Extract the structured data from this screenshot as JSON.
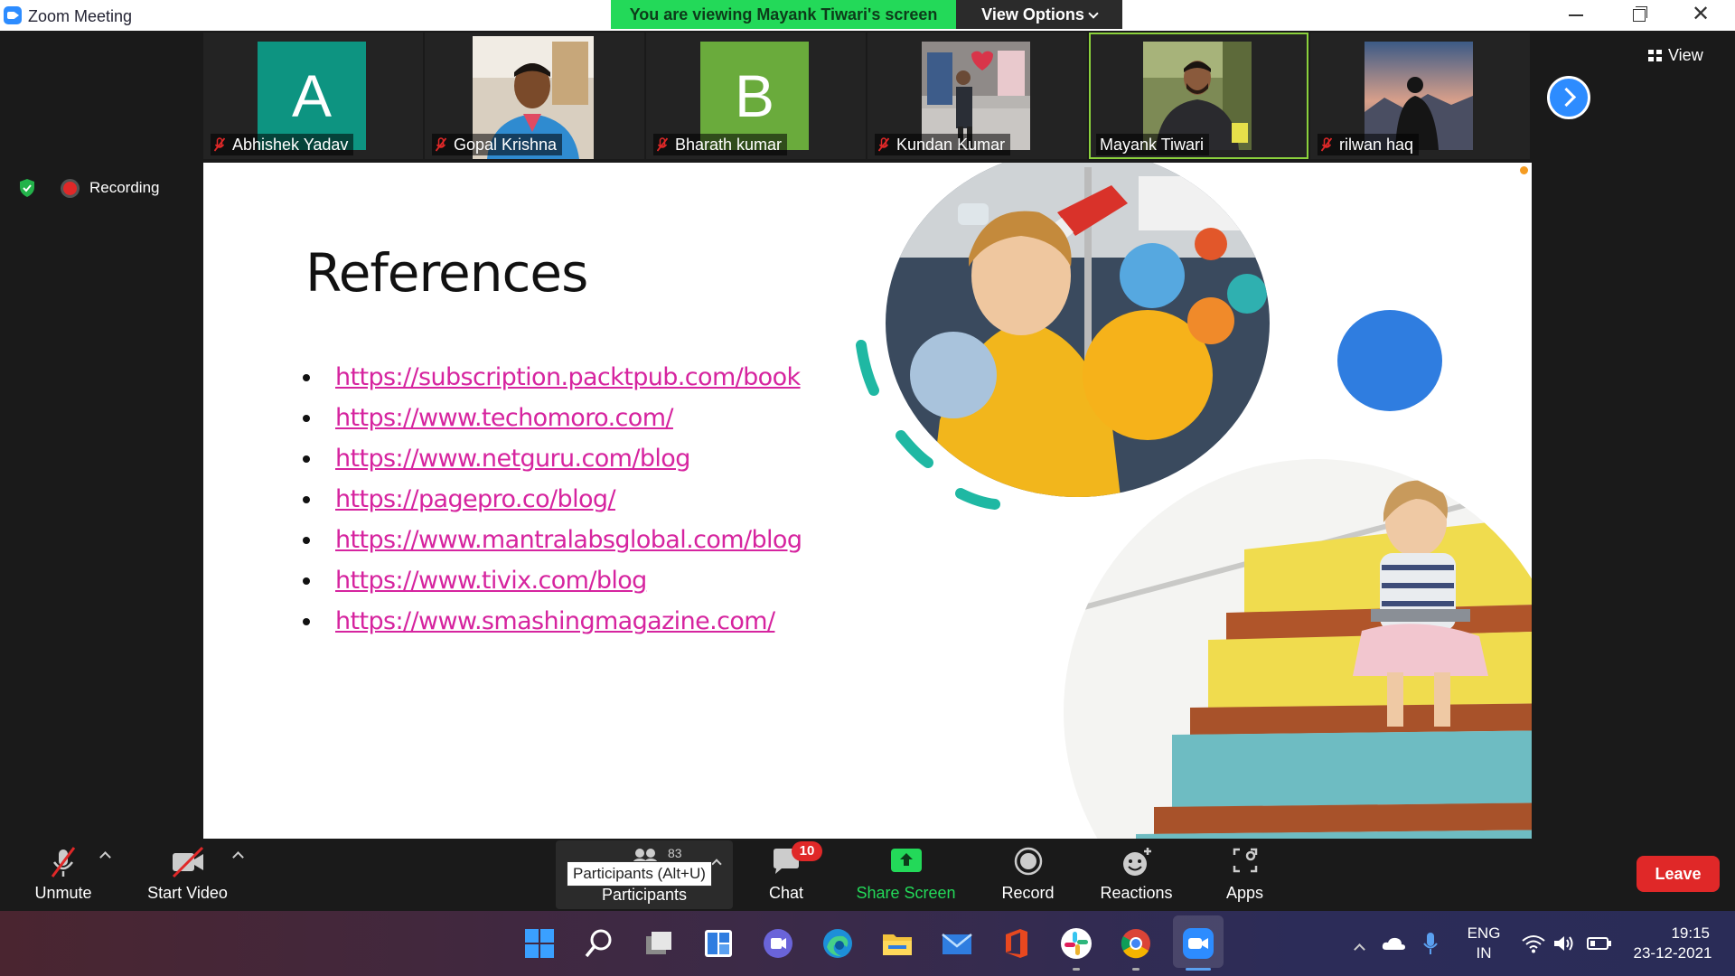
{
  "window": {
    "title": "Zoom Meeting",
    "viewing_banner": "You are viewing Mayank Tiwari's screen",
    "view_options": "View Options"
  },
  "filmstrip": {
    "participants": [
      {
        "name": "Abhishek Yadav",
        "avatar": "letter",
        "letter": "A",
        "color": "#0d9481",
        "muted": true,
        "active": false
      },
      {
        "name": "Gopal Krishna",
        "avatar": "photo",
        "muted": true,
        "active": false
      },
      {
        "name": "Bharath kumar",
        "avatar": "letter",
        "letter": "B",
        "color": "#6aab3c",
        "muted": true,
        "active": false
      },
      {
        "name": "Kundan Kumar",
        "avatar": "photo",
        "muted": true,
        "active": false
      },
      {
        "name": "Mayank Tiwari",
        "avatar": "photo",
        "muted": false,
        "active": true
      },
      {
        "name": "rilwan haq",
        "avatar": "photo",
        "muted": true,
        "active": false
      }
    ],
    "view_label": "View"
  },
  "status": {
    "recording_label": "Recording"
  },
  "slide": {
    "title": "References",
    "links": [
      "https://subscription.packtpub.com/book",
      "https://www.techomoro.com/",
      "https://www.netguru.com/blog",
      "https://pagepro.co/blog/",
      "https://www.mantralabsglobal.com/blog",
      "https://www.tivix.com/blog",
      "https://www.smashingmagazine.com/"
    ],
    "link_color": "#d6249f",
    "accent_teal": "#1fb8a3",
    "accent_blue": "#2f7de0"
  },
  "controls": {
    "unmute": "Unmute",
    "start_video": "Start Video",
    "participants": "Participants",
    "participants_count": "83",
    "participants_tooltip": "Participants (Alt+U)",
    "chat": "Chat",
    "chat_badge": "10",
    "share_screen": "Share Screen",
    "record": "Record",
    "reactions": "Reactions",
    "apps": "Apps",
    "leave": "Leave",
    "share_color": "#23d959",
    "leave_color": "#e02828"
  },
  "taskbar": {
    "language_top": "ENG",
    "language_bottom": "IN",
    "time": "19:15",
    "date": "23-12-2021"
  }
}
